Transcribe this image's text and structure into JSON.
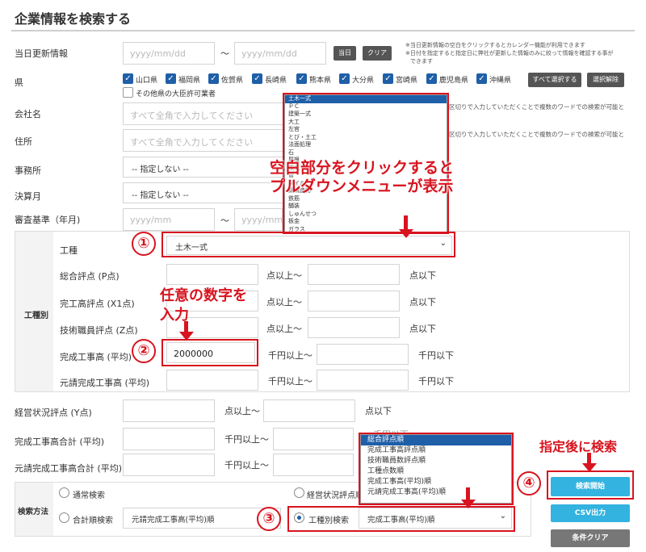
{
  "page_title": "企業情報を検索する",
  "update": {
    "label": "当日更新情報",
    "from_placeholder": "yyyy/mm/dd",
    "tilde": "～",
    "to_placeholder": "yyyy/mm/dd",
    "today_btn": "当日",
    "clear_btn": "クリア",
    "note1": "※当日更新情報の空白をクリックするとカレンダー機能が利用できます",
    "note2": "※日付を指定すると指定日に弊社が更新した情報のみに絞って情報を確認する事が",
    "note3": "できます"
  },
  "prefecture": {
    "label": "県",
    "items": [
      "山口県",
      "福岡県",
      "佐賀県",
      "長崎県",
      "熊本県",
      "大分県",
      "宮崎県",
      "鹿児島県",
      "沖縄県"
    ],
    "other": "その他県の大臣許可業者",
    "select_all": "すべて選択する",
    "deselect": "選択解除"
  },
  "company": {
    "label": "会社名",
    "placeholder": "すべて全角で入力してください",
    "note": "区切りで入力していただくことで複数のワードでの検索が可能と"
  },
  "address": {
    "label": "住所",
    "placeholder": "すべて全角で入力してください",
    "note": "区切りで入力していただくことで複数のワードでの検索が可能と"
  },
  "office": {
    "label": "事務所",
    "value": "-- 指定しない --"
  },
  "settlement": {
    "label": "決算月",
    "value": "-- 指定しない --"
  },
  "exam_base": {
    "label": "審査基準（年月)",
    "from_placeholder": "yyyy/mm",
    "tilde": "～",
    "to_placeholder": "yyyy/mm"
  },
  "work_type_group": {
    "title": "工種別",
    "work_type_label": "工種",
    "work_type_value": "土木一式",
    "total_score_label": "総合評点 (P点)",
    "completed_score_label": "完工高評点 (X1点)",
    "tech_score_label": "技術職員評点 (Z点)",
    "completed_avg_label": "完成工事高 (平均)",
    "completed_avg_value": "2000000",
    "prime_avg_label": "元請完成工事高 (平均)",
    "pts_above": "点以上～",
    "pts_below": "点以下",
    "yen_above": "千円以上～",
    "yen_below": "千円以下"
  },
  "biz_score": {
    "label": "経営状況評点 (Y点)",
    "above": "点以上～",
    "below": "点以下"
  },
  "completed_total": {
    "label": "完成工事高合計 (平均)",
    "above": "千円以上～",
    "below": "千円以下"
  },
  "prime_total": {
    "label": "元請完成工事高合計 (平均)",
    "above": "千円以上～"
  },
  "search_method": {
    "title": "検索方法",
    "normal": "通常検索",
    "biz_score_order": "経営状況評点順",
    "sum_order": "合計順検索",
    "sum_order_value": "元請完成工事高(平均)順",
    "work_type_search": "工種別検索",
    "work_type_search_value": "完成工事高(平均)順"
  },
  "sort_dropdown": [
    "総合評点順",
    "完成工事高評点順",
    "技術職員数評点順",
    "工種点数順",
    "完成工事高(平均)順",
    "元請完成工事高(平均)順"
  ],
  "work_dropdown": [
    "土木一式",
    "ＰＣ",
    "建築一式",
    "大工",
    "左官",
    "とび・土工",
    "法面処理",
    "石",
    "屋根",
    "電気",
    "管",
    "タイル",
    "鋼構造物",
    "鉄筋",
    "舗装",
    "しゅんせつ",
    "板金",
    "ガラス"
  ],
  "buttons": {
    "search": "検索開始",
    "csv": "CSV出力",
    "clear": "条件クリア"
  },
  "annotations": {
    "callout1_line1": "空白部分をクリックすると",
    "callout1_line2": "プルダウンメニューが表示",
    "callout2_line1": "任意の数字を",
    "callout2_line2": "入力",
    "callout4": "指定後に検索",
    "num1": "①",
    "num2": "②",
    "num3": "③",
    "num4": "④"
  },
  "colors": {
    "accent": "#1f5fa8",
    "search_btn": "#33b3e0",
    "annotation": "#d8141f",
    "section_bg": "#f3f3f3"
  }
}
